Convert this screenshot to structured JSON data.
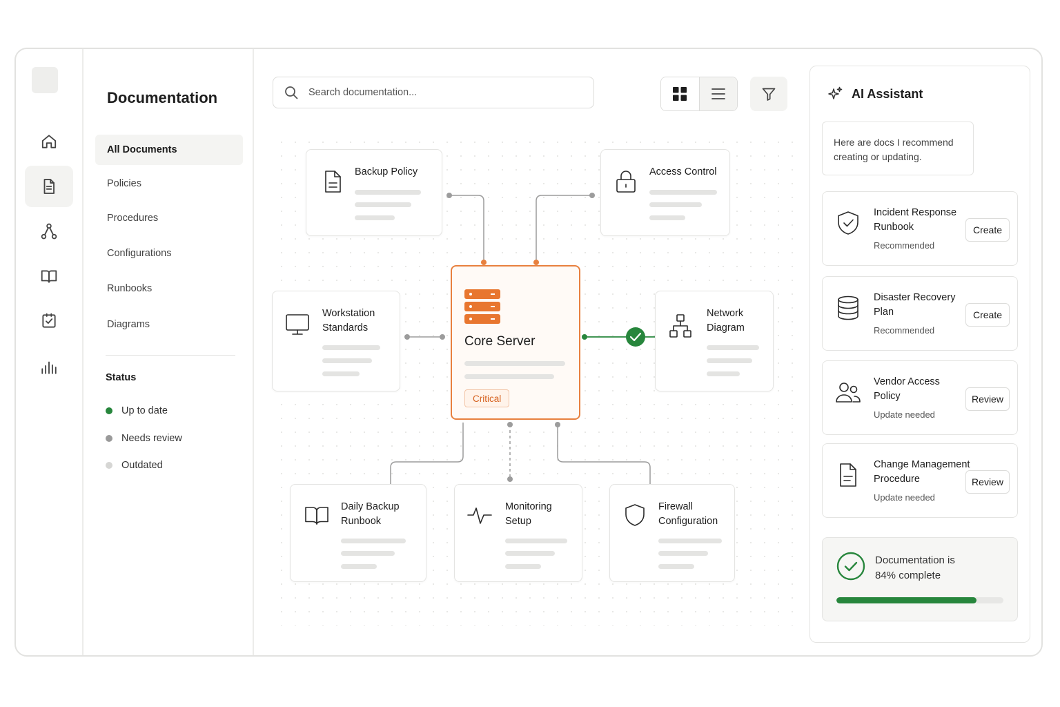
{
  "colors": {
    "accent": "#e8762f",
    "success": "#27863c",
    "neutral_dot": "#9a9a9a",
    "light_dot": "#d6d6d4"
  },
  "rail": {
    "icons": [
      "home-icon",
      "document-icon",
      "hierarchy-icon",
      "book-icon",
      "checklist-icon",
      "bar-chart-icon"
    ],
    "active": "document-icon"
  },
  "nav": {
    "title": "Documentation",
    "items": [
      "All Documents",
      "Policies",
      "Procedures",
      "Configurations",
      "Runbooks",
      "Diagrams"
    ],
    "active": "All Documents",
    "status_heading": "Status",
    "statuses": [
      "Up to date",
      "Needs review",
      "Outdated"
    ]
  },
  "toolbar": {
    "search_placeholder": "Search documentation...",
    "view_modes": [
      "grid-view-icon",
      "list-view-icon"
    ],
    "active_view": "grid-view-icon",
    "filter_icon": "filter-icon"
  },
  "diagram": {
    "core": {
      "title": "Core Server",
      "badge": "Critical",
      "icon": "server-stack-icon"
    },
    "nodes": {
      "backup_policy": {
        "title": "Backup Policy",
        "icon": "document-icon"
      },
      "access_control": {
        "title": "Access Control",
        "icon": "lock-icon"
      },
      "workstation": {
        "line1": "Workstation",
        "line2": "Standards",
        "icon": "monitor-icon"
      },
      "network": {
        "line1": "Network",
        "line2": "Diagram",
        "icon": "network-icon"
      },
      "daily_backup": {
        "line1": "Daily Backup",
        "line2": "Runbook",
        "icon": "book-icon"
      },
      "monitoring": {
        "line1": "Monitoring",
        "line2": "Setup",
        "icon": "pulse-icon"
      },
      "firewall": {
        "line1": "Firewall",
        "line2": "Configuration",
        "icon": "shield-icon"
      }
    },
    "verified_link_icon": "check-circle-icon"
  },
  "assistant": {
    "title": "AI Assistant",
    "icon": "sparkle-icon",
    "message": "Here are docs I recommend creating or updating.",
    "recommendations": [
      {
        "line1": "Incident Response",
        "line2": "Runbook",
        "status": "Recommended",
        "action": "Create",
        "icon": "shield-check-icon"
      },
      {
        "line1": "Disaster Recovery",
        "line2": "Plan",
        "status": "Recommended",
        "action": "Create",
        "icon": "database-icon"
      },
      {
        "line1": "Vendor Access",
        "line2": "Policy",
        "status": "Update needed",
        "action": "Review",
        "icon": "users-icon"
      },
      {
        "line1": "Change Management",
        "line2": "Procedure",
        "status": "Update needed",
        "action": "Review",
        "icon": "document-icon"
      }
    ],
    "progress": {
      "line1": "Documentation is",
      "line2": "84% complete",
      "value": 0.84
    }
  }
}
